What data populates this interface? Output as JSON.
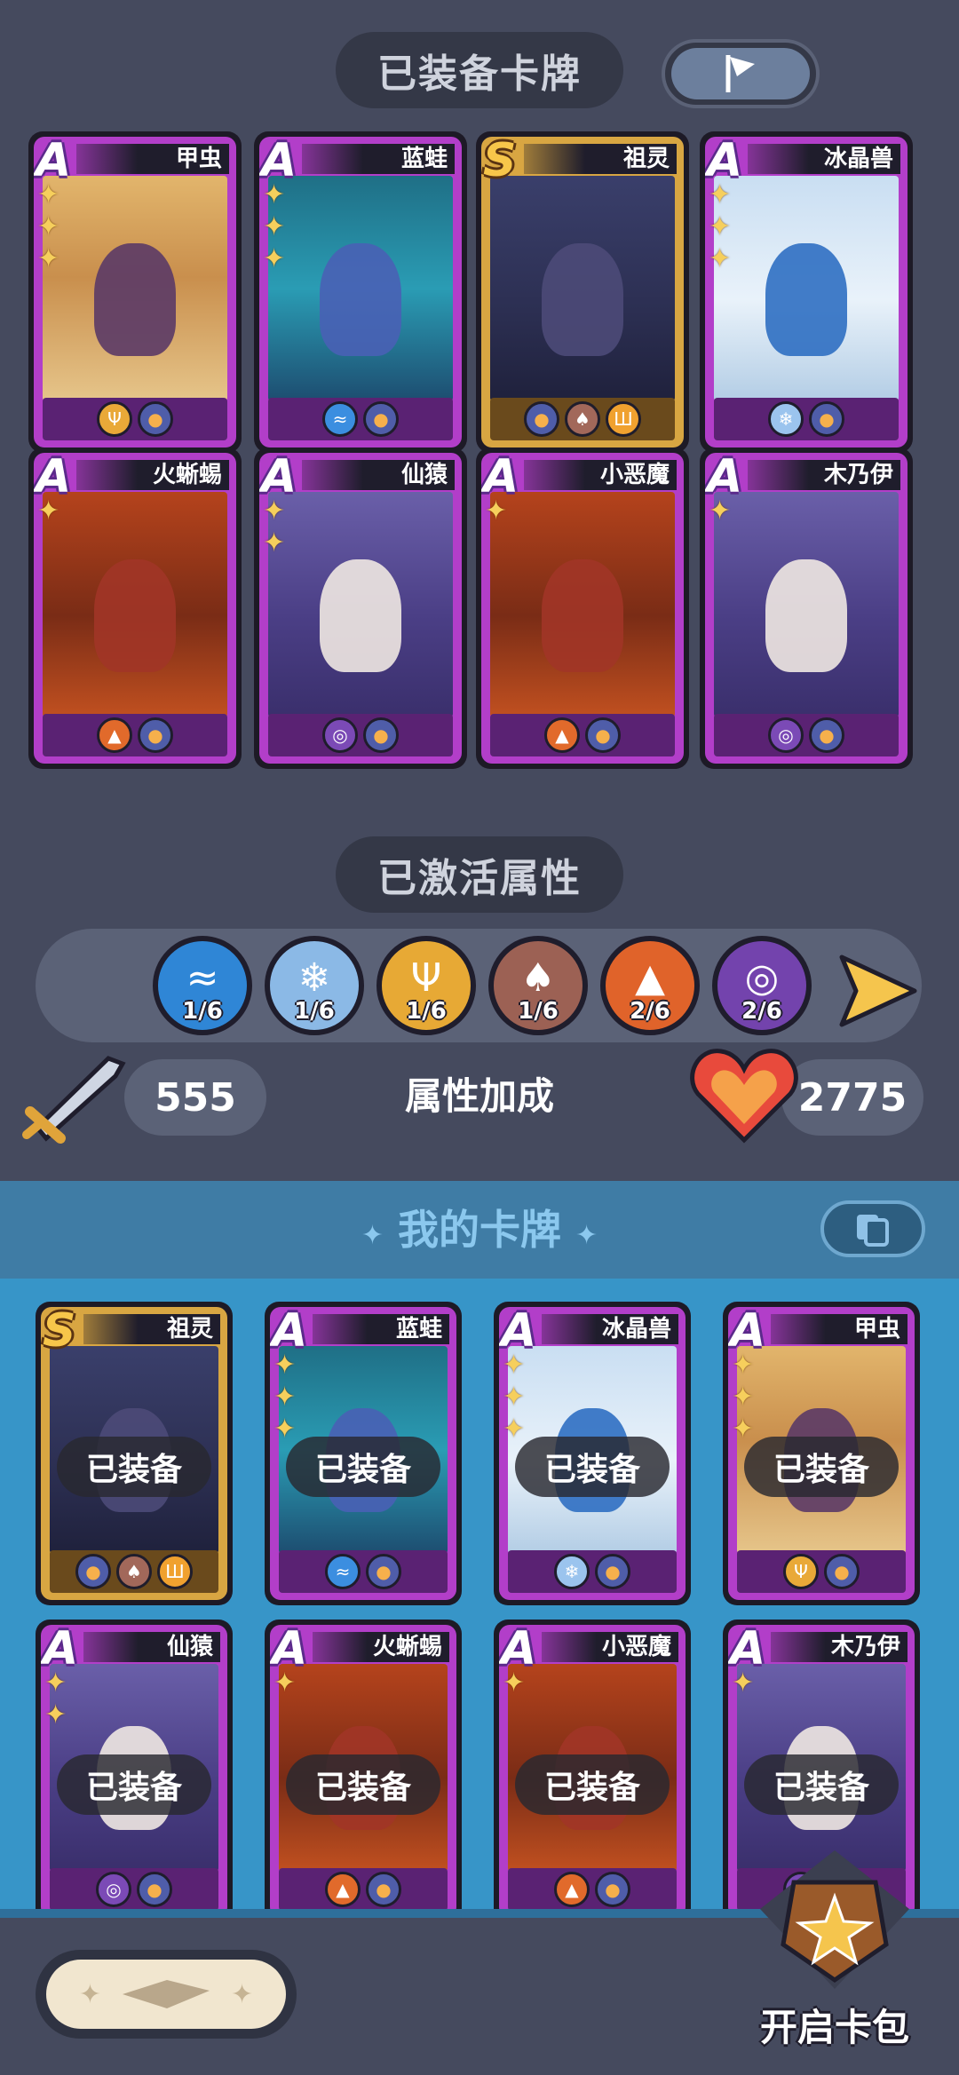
{
  "header": {
    "equipped_title": "已装备卡牌"
  },
  "equipped_cards": [
    {
      "grade": "A",
      "name": "甲虫",
      "stars": 3,
      "tags": [
        "cactus",
        "paw"
      ],
      "art": "desert"
    },
    {
      "grade": "A",
      "name": "蓝蛙",
      "stars": 3,
      "tags": [
        "water",
        "paw"
      ],
      "art": "ocean"
    },
    {
      "grade": "S",
      "name": "祖灵",
      "stars": 0,
      "tags": [
        "paw",
        "squid",
        "altar"
      ],
      "art": "spirit"
    },
    {
      "grade": "A",
      "name": "冰晶兽",
      "stars": 3,
      "tags": [
        "ice",
        "paw"
      ],
      "art": "snow"
    },
    {
      "grade": "A",
      "name": "火蜥蜴",
      "stars": 1,
      "tags": [
        "fire",
        "paw"
      ],
      "art": "lava"
    },
    {
      "grade": "A",
      "name": "仙猿",
      "stars": 2,
      "tags": [
        "swirl",
        "paw"
      ],
      "art": "temple"
    },
    {
      "grade": "A",
      "name": "小恶魔",
      "stars": 1,
      "tags": [
        "fire",
        "paw"
      ],
      "art": "lava"
    },
    {
      "grade": "A",
      "name": "木乃伊",
      "stars": 1,
      "tags": [
        "swirl",
        "paw"
      ],
      "art": "temple"
    }
  ],
  "attributes_title": "已激活属性",
  "attributes": [
    {
      "icon": "water",
      "count": "1/6"
    },
    {
      "icon": "ice",
      "count": "1/6"
    },
    {
      "icon": "cactus",
      "count": "1/6"
    },
    {
      "icon": "squid",
      "count": "1/6"
    },
    {
      "icon": "fire",
      "count": "2/6"
    },
    {
      "icon": "swirl",
      "count": "2/6"
    }
  ],
  "stats": {
    "attack": "555",
    "bonus_label": "属性加成",
    "health": "2775"
  },
  "my_cards_title": "我的卡牌",
  "my_cards": [
    {
      "grade": "S",
      "name": "祖灵",
      "stars": 0,
      "tags": [
        "paw",
        "squid",
        "altar"
      ],
      "art": "spirit",
      "status": "已装备"
    },
    {
      "grade": "A",
      "name": "蓝蛙",
      "stars": 3,
      "tags": [
        "water",
        "paw"
      ],
      "art": "ocean",
      "status": "已装备"
    },
    {
      "grade": "A",
      "name": "冰晶兽",
      "stars": 3,
      "tags": [
        "ice",
        "paw"
      ],
      "art": "snow",
      "status": "已装备"
    },
    {
      "grade": "A",
      "name": "甲虫",
      "stars": 3,
      "tags": [
        "cactus",
        "paw"
      ],
      "art": "desert",
      "status": "已装备"
    },
    {
      "grade": "A",
      "name": "仙猿",
      "stars": 2,
      "tags": [
        "swirl",
        "paw"
      ],
      "art": "temple",
      "status": "已装备"
    },
    {
      "grade": "A",
      "name": "火蜥蜴",
      "stars": 1,
      "tags": [
        "fire",
        "paw"
      ],
      "art": "lava",
      "status": "已装备"
    },
    {
      "grade": "A",
      "name": "小恶魔",
      "stars": 1,
      "tags": [
        "fire",
        "paw"
      ],
      "art": "lava",
      "status": "已装备"
    },
    {
      "grade": "A",
      "name": "木乃伊",
      "stars": 1,
      "tags": [
        "swirl",
        "paw"
      ],
      "art": "temple",
      "status": "已装备"
    }
  ],
  "footer": {
    "open_pack_label": "开启卡包"
  }
}
